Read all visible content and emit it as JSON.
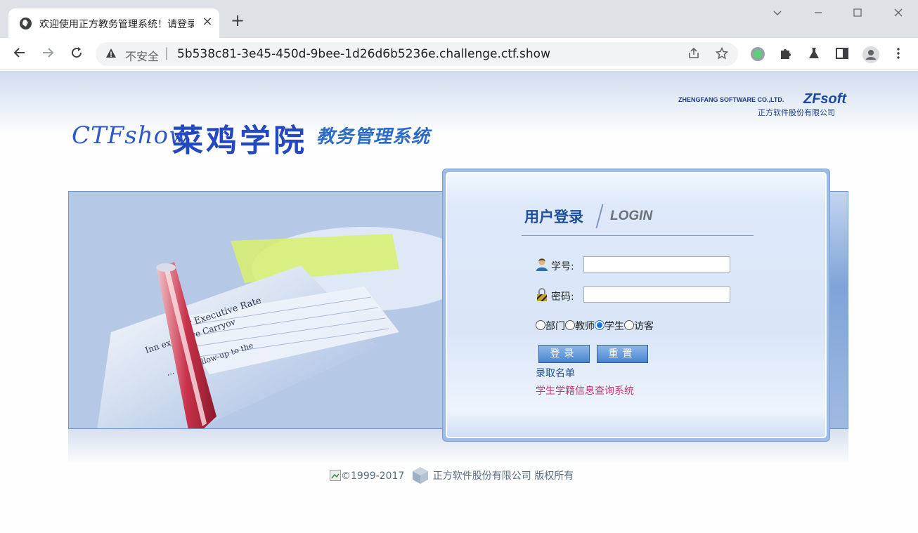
{
  "browser": {
    "tab_title": "欢迎使用正方教务管理系统！请登录",
    "tab_close": "×",
    "new_tab": "+",
    "security_label": "不安全",
    "url": "5b538c81-3e45-450d-9bee-1d26d6b5236e.challenge.ctf.show",
    "window_controls": [
      "chevron-down-icon",
      "minimize-icon",
      "maximize-icon",
      "close-icon"
    ],
    "toolbar_icons": [
      "back-icon",
      "forward-icon",
      "reload-icon",
      "share-icon",
      "bookmark-star-icon",
      "extension-green-icon",
      "puzzle-icon",
      "flask-icon",
      "sidepanel-icon",
      "profile-icon",
      "menu-icon"
    ]
  },
  "header": {
    "brand_ctf": "CTFshow",
    "brand_school": "菜鸡学院",
    "brand_system": "教务管理系统",
    "vendor_en": "ZHENGFANG SOFTWARE CO.,LTD.",
    "vendor_logo": "ZFsoft",
    "vendor_cn": "正方软件股份有限公司"
  },
  "login": {
    "title": "用户登录",
    "subtitle": "LOGIN",
    "username_label": "学号:",
    "username_value": "",
    "password_label": "密码:",
    "password_value": "",
    "roles": [
      {
        "label": "部门",
        "checked": false
      },
      {
        "label": "教师",
        "checked": false
      },
      {
        "label": "学生",
        "checked": true
      },
      {
        "label": "访客",
        "checked": false
      }
    ],
    "login_button": "登录",
    "reset_button": "重置",
    "admission_link": "录取名单",
    "status_link": "学生学籍信息查询系统"
  },
  "footer": {
    "copyright": "©1999-2017",
    "company": "正方软件股份有限公司 版权所有"
  },
  "colors": {
    "brand_blue": "#2448c0",
    "panel_blue": "#9fbce6",
    "link_pink": "#c33b6e"
  }
}
